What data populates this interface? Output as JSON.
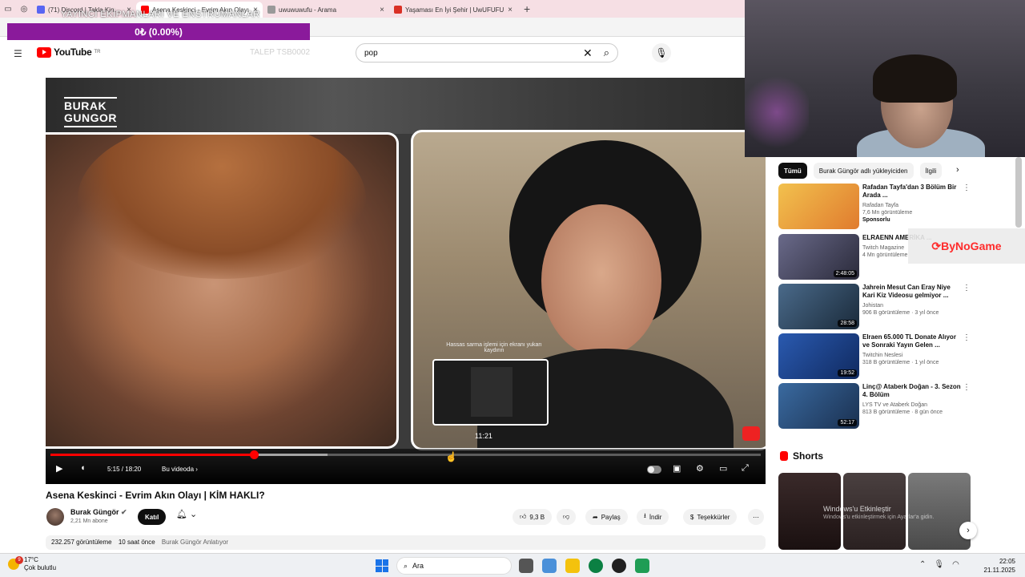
{
  "browser": {
    "tabs": [
      {
        "title": "(71) Discord | Takla Kingdom",
        "active": false,
        "color": "#5865F2"
      },
      {
        "title": "Asena Keskinci - Evrim Akın Olayı",
        "active": true,
        "color": "#ff0000"
      },
      {
        "title": "uwuwuwufu - Arama",
        "active": false,
        "color": "#777777"
      },
      {
        "title": "Yaşaması En İyi Şehir | UwUFUFU",
        "active": false,
        "color": "#d93025"
      }
    ]
  },
  "overlay": {
    "title": "YAYINCI EKİPMANLARI VE ENSTRÜMANLAR",
    "donation": "0₺ (0.00%)"
  },
  "youtube": {
    "logo": "YouTube",
    "region": "TR",
    "ghost_text": "TALEP TSB0002",
    "search_value": "pop"
  },
  "player": {
    "brand_line1": "BURAK",
    "brand_line2": "GUNGOR",
    "hover_hint": "Hassas sarma işlemi için ekranı yukarı kaydırın",
    "preview_time": "11:21",
    "time": "5:15 / 18:20",
    "chapter": "Bu videoda ›",
    "progress_played": 0.2863,
    "progress_buffered": 0.39
  },
  "video": {
    "title": "Asena Keskinci - Evrim Akın Olayı | KİM HAKLI?",
    "channel": "Burak Güngör",
    "subscribers": "2,21 Mn abone",
    "join_label": "Katıl",
    "likes": "9,3 B",
    "share_label": "Paylaş",
    "download_label": "İndir",
    "thanks_label": "Teşekkürler",
    "views": "232.257 görüntüleme",
    "age": "10 saat önce",
    "desc_channel": "Burak Güngör Anlatıyor"
  },
  "sidebar": {
    "chips": [
      "Tümü",
      "Burak Güngör adlı yükleyiciden",
      "İlgili"
    ],
    "recommendations": [
      {
        "title": "Rafadan Tayfa'dan 3 Bölüm Bir Arada ...",
        "channel": "Rafadan Tayfa",
        "views": "7,6 Mn görüntüleme",
        "extra": "Sponsorlu",
        "duration": "",
        "thumb": "#e8a030"
      },
      {
        "title": "ELRAENN AMERİKA ...",
        "channel": "Twitch Magazine",
        "views": "4 Mn görüntüleme",
        "extra": "",
        "duration": "2:48:05",
        "thumb": "#4a4a6a"
      },
      {
        "title": "Jahrein Mesut Can Eray Niye Kari Kiz Videosu gelmiyor ...",
        "channel": "Johistan",
        "views": "906 B görüntüleme · 3 yıl önce",
        "extra": "",
        "duration": "28:58",
        "thumb": "#3a5a7a"
      },
      {
        "title": "Elraen 65.000 TL Donate Alıyor ve Sonraki Yayın Gelen ...",
        "channel": "Twitchin Neslesi",
        "views": "318 B görüntüleme · 1 yıl önce",
        "extra": "",
        "duration": "19:52",
        "thumb": "#2850a0"
      },
      {
        "title": "Linç@ Ataberk Doğan - 3. Sezon 4. Bölüm",
        "channel": "LYS TV ve Ataberk Doğan",
        "views": "813 B görüntüleme · 8 gün önce",
        "extra": "",
        "duration": "52:17",
        "thumb": "#305080"
      }
    ],
    "badge_text": "ByNoGame",
    "shorts_label": "Shorts",
    "watermark_line1": "Windows'u Etkinleştir",
    "watermark_line2": "Windows'u etkinleştirmek için Ayarlar'a gidin.",
    "short_colors": [
      "#2a2020",
      "#3a3030",
      "#6a6a6a"
    ]
  },
  "taskbar": {
    "temp": "17°C",
    "weather": "Çok bulutlu",
    "notif_count": "9",
    "search_placeholder": "Ara",
    "time": "22:05",
    "date": "21.11.2025",
    "apps": [
      "#555555",
      "#4a90d9",
      "#f4c20d",
      "#0b8043",
      "#202020",
      "#1f9d55"
    ]
  }
}
